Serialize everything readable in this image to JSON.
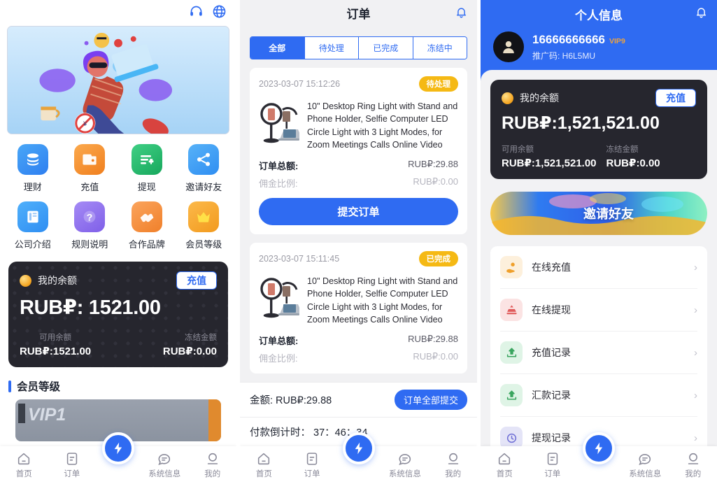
{
  "home": {
    "header": {
      "support_icon": "headset-icon",
      "language_icon": "globe-icon"
    },
    "banner_alt": "hero-illustration",
    "quick_actions": [
      {
        "label": "理财",
        "icon": "coins-stack-icon",
        "color": "#2f8ef2"
      },
      {
        "label": "充值",
        "icon": "wallet-icon",
        "color": "#f59432"
      },
      {
        "label": "提现",
        "icon": "withdraw-list-icon",
        "color": "#27b86f"
      },
      {
        "label": "邀请好友",
        "icon": "share-icon",
        "color": "#3a9df5"
      },
      {
        "label": "公司介绍",
        "icon": "book-icon",
        "color": "#2f9cf5"
      },
      {
        "label": "规则说明",
        "icon": "question-icon",
        "color": "#8b6ff0"
      },
      {
        "label": "合作品牌",
        "icon": "handshake-icon",
        "color": "#f5893a"
      },
      {
        "label": "会员等级",
        "icon": "crown-icon",
        "color": "#f5a623"
      }
    ],
    "balance": {
      "title": "我的余额",
      "topup_label": "充值",
      "amount": "RUB₽: 1521.00",
      "available_label": "可用余额",
      "available_value": "RUB₽:1521.00",
      "frozen_label": "冻结金额",
      "frozen_value": "RUB₽:0.00"
    },
    "vip_section": {
      "title": "会员等级",
      "card_label": "VIP1"
    }
  },
  "orders": {
    "title": "订单",
    "bell_icon": "bell-icon",
    "tabs": [
      {
        "label": "全部",
        "active": true
      },
      {
        "label": "待处理",
        "active": false
      },
      {
        "label": "已完成",
        "active": false
      },
      {
        "label": "冻结中",
        "active": false
      }
    ],
    "items": [
      {
        "date": "2023-03-07 15:12:26",
        "status": "待处理",
        "product": "10\" Desktop Ring Light with Stand and Phone Holder, Selfie Computer LED Circle Light with 3 Light Modes, for Zoom Meetings Calls Online Video",
        "total_label": "订单总额:",
        "total_value": "RUB₽:29.88",
        "commission_label": "佣金比例:",
        "commission_value": "RUB₽:0.00",
        "action_label": "提交订单"
      },
      {
        "date": "2023-03-07 15:11:45",
        "status": "已完成",
        "product": "10\" Desktop Ring Light with Stand and Phone Holder, Selfie Computer LED Circle Light with 3 Light Modes, for Zoom Meetings Calls Online Video",
        "total_label": "订单总额:",
        "total_value": "RUB₽:29.88",
        "commission_label": "佣金比例:",
        "commission_value": "RUB₽:0.00",
        "action_label": ""
      }
    ],
    "footer": {
      "amount_text": "金额: RUB₽:29.88",
      "submit_all_label": "订单全部提交",
      "countdown_text": "付款倒计时： 37：46：34"
    }
  },
  "profile": {
    "title": "个人信息",
    "bell_icon": "bell-icon",
    "user": {
      "phone": "16666666666",
      "vip": "VIP9",
      "promo_label": "推广码: H6L5MU",
      "avatar_icon": "user-avatar-icon"
    },
    "balance": {
      "title": "我的余额",
      "topup_label": "充值",
      "amount": "RUB₽:1,521,521.00",
      "available_label": "可用余额",
      "available_value": "RUB₽:1,521,521.00",
      "frozen_label": "冻结金额",
      "frozen_value": "RUB₽:0.00"
    },
    "invite_banner": {
      "label": "邀请好友"
    },
    "menu": [
      {
        "label": "在线充值",
        "icon": "hand-coin-icon",
        "bg": "#fdf0dc",
        "fg": "#ef9f2a"
      },
      {
        "label": "在线提现",
        "icon": "fountain-icon",
        "bg": "#fbe3e3",
        "fg": "#e05a5a"
      },
      {
        "label": "充值记录",
        "icon": "upload-box-icon",
        "bg": "#dff4e6",
        "fg": "#3aa55f"
      },
      {
        "label": "汇款记录",
        "icon": "upload-box-icon",
        "bg": "#dff4e6",
        "fg": "#3aa55f"
      },
      {
        "label": "提现记录",
        "icon": "refresh-circle-icon",
        "bg": "#e4e4f7",
        "fg": "#6f6fd6"
      }
    ],
    "chevron": "›"
  },
  "tabbar": {
    "items": [
      {
        "label": "首页",
        "icon": "home-icon"
      },
      {
        "label": "订单",
        "icon": "order-list-icon"
      },
      {
        "label": "",
        "icon": "lightning-fab-icon"
      },
      {
        "label": "系统信息",
        "icon": "message-icon"
      },
      {
        "label": "我的",
        "icon": "person-icon"
      }
    ]
  },
  "colors": {
    "brand_blue": "#2f6bf2",
    "amber": "#f5b914",
    "card_dark": "#26262e",
    "page_bg": "#f2f2f4"
  }
}
